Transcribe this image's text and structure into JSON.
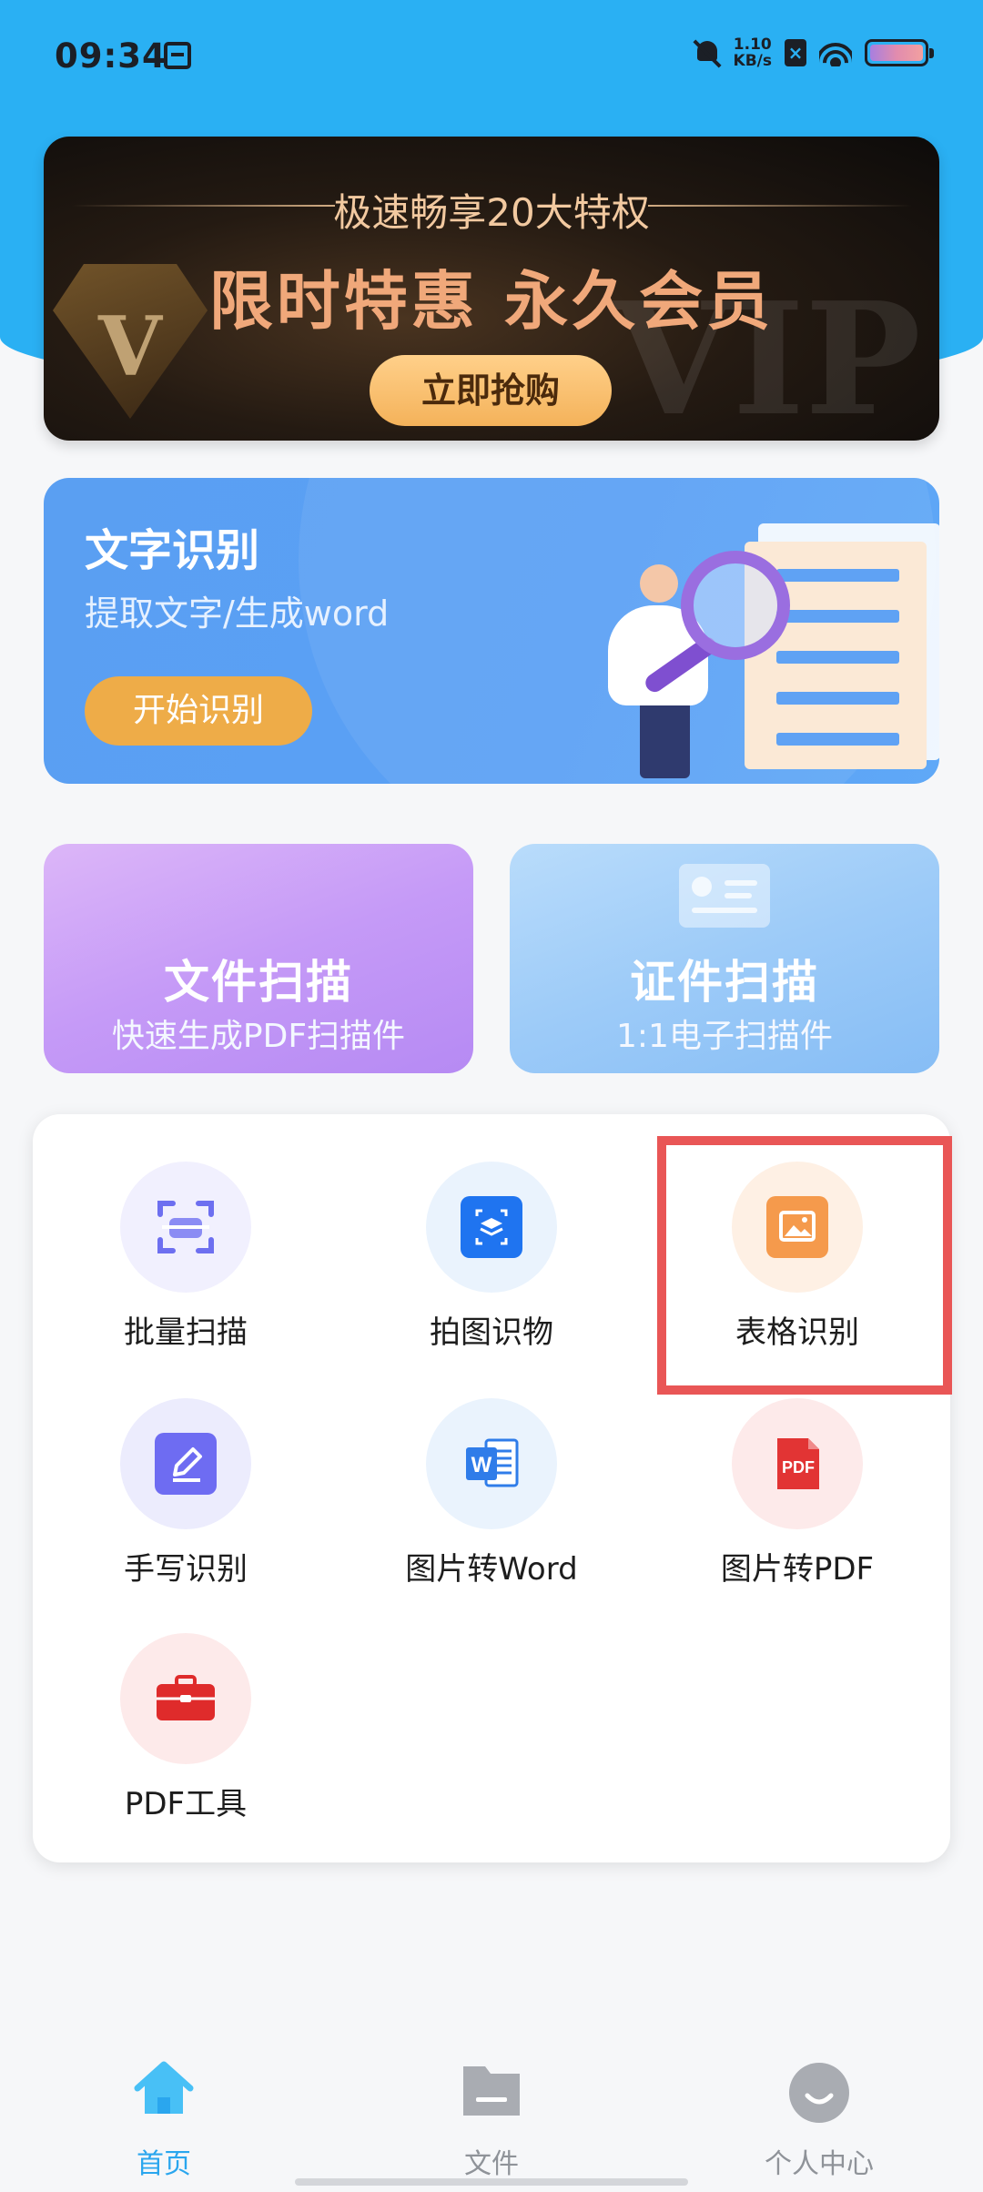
{
  "status_bar": {
    "time": "09:34",
    "net_speed_top": "1.10",
    "net_speed_bottom": "KB/s",
    "sim_icon_text": "×"
  },
  "vip_banner": {
    "subtitle": "极速畅享20大特权",
    "title": "限时特惠 永久会员",
    "button": "立即抢购",
    "watermark": "VIP",
    "gem_letter": "V"
  },
  "ocr_card": {
    "title": "文字识别",
    "subtitle": "提取文字/生成word",
    "button": "开始识别"
  },
  "scan_cards": {
    "doc_title": "文件扫描",
    "doc_sub": "快速生成PDF扫描件",
    "id_title": "证件扫描",
    "id_sub": "1:1电子扫描件"
  },
  "tools": [
    {
      "label": "批量扫描",
      "icon": "batch-scan-icon",
      "color": "#6d6ff0"
    },
    {
      "label": "拍图识物",
      "icon": "object-recognition-icon",
      "color": "#1f74f0"
    },
    {
      "label": "表格识别",
      "icon": "table-recognition-icon",
      "color": "#f59a4c"
    },
    {
      "label": "手写识别",
      "icon": "handwriting-icon",
      "color": "#6e6cf2"
    },
    {
      "label": "图片转Word",
      "icon": "word-icon",
      "color": "#2f7ce9"
    },
    {
      "label": "图片转PDF",
      "icon": "pdf-icon",
      "color": "#e23434"
    },
    {
      "label": "PDF工具",
      "icon": "toolbox-icon",
      "color": "#df2b2b"
    }
  ],
  "tab_bar": {
    "home": "首页",
    "files": "文件",
    "profile": "个人中心",
    "active_color": "#2aa6ee",
    "inactive_color": "#8f9399"
  }
}
